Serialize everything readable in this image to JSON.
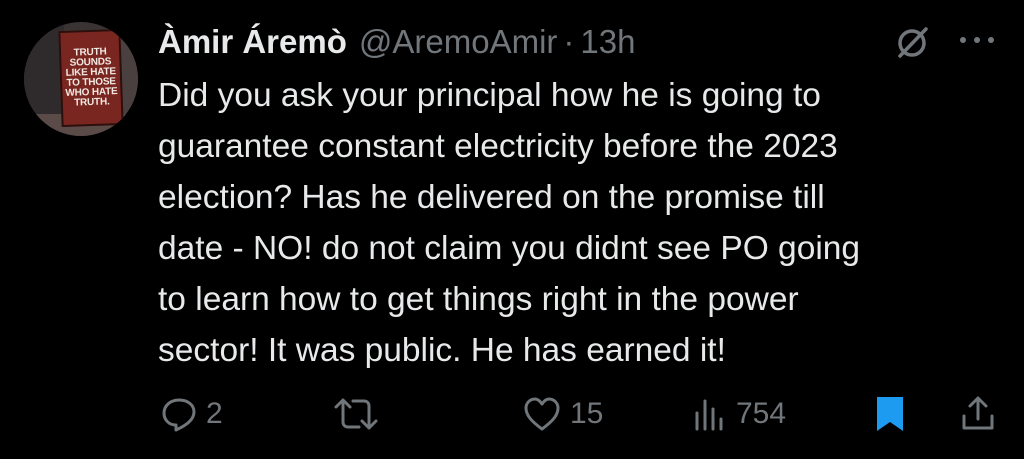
{
  "tweet": {
    "author_name": "Àmir Áremò",
    "author_handle": "@AremoAmir",
    "separator": "·",
    "time": "13h",
    "text": "Did you ask your principal how he is going to\nguarantee constant electricity  before the 2023\nelection? Has he delivered on the promise till\ndate - NO! do not claim you didnt see PO going\nto learn how to get things right in the power\nsector! It was public. He has earned it!"
  },
  "avatar": {
    "sign_lines": [
      "TRUTH",
      "SOUNDS",
      "LIKE HATE",
      "TO THOSE",
      "WHO HATE",
      "TRUTH."
    ]
  },
  "actions": {
    "replies": "2",
    "retweets": "",
    "likes": "15",
    "views": "754"
  },
  "icons": {
    "grok": "grok-icon",
    "more": "more-horizontal-icon",
    "reply": "reply-icon",
    "retweet": "retweet-icon",
    "like": "heart-icon",
    "views": "views-chart-icon",
    "bookmark": "bookmark-icon",
    "share": "share-icon"
  },
  "colors": {
    "background": "#000000",
    "text": "#e7e9ea",
    "muted": "#71767b",
    "bookmark_active": "#1d9bf0"
  }
}
